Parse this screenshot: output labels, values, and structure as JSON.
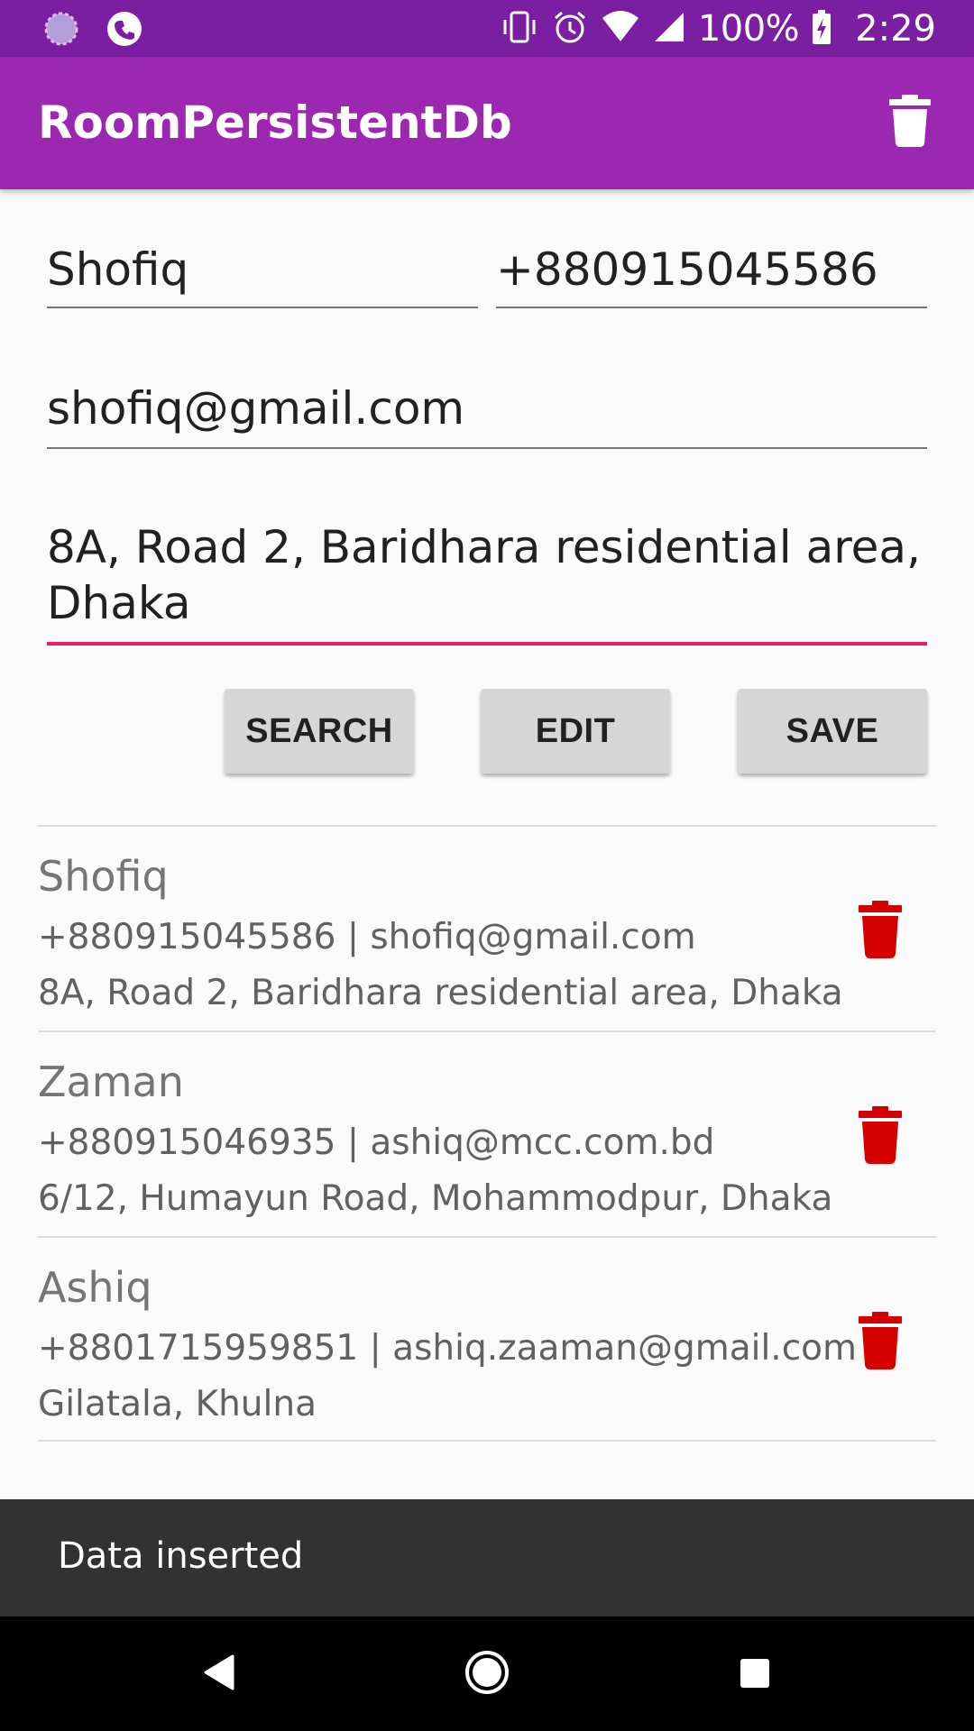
{
  "status_bar": {
    "battery": "100%",
    "time": "2:29"
  },
  "app_bar": {
    "title": "RoomPersistentDb"
  },
  "form": {
    "name": "Shofiq",
    "phone": "+880915045586",
    "email": "shofiq@gmail.com",
    "address": "8A, Road 2, Baridhara residential area, Dhaka"
  },
  "buttons": {
    "search": "SEARCH",
    "edit": "EDIT",
    "save": "SAVE"
  },
  "contacts": [
    {
      "name": "Shofiq",
      "contact": "+880915045586 | shofiq@gmail.com",
      "address": "8A, Road 2, Baridhara residential area, Dhaka"
    },
    {
      "name": "Zaman",
      "contact": "+880915046935 | ashiq@mcc.com.bd",
      "address": "6/12, Humayun Road, Mohammodpur, Dhaka"
    },
    {
      "name": "Ashiq",
      "contact": "+8801715959851 | ashiq.zaaman@gmail.com",
      "address": "Gilatala, Khulna"
    }
  ],
  "snackbar": {
    "message": "Data inserted"
  },
  "colors": {
    "status_bar": "#7b1fa2",
    "app_bar": "#9c27b0",
    "accent": "#e91e63",
    "delete_icon": "#d50000"
  },
  "icons": {
    "status_left": [
      "loading-icon",
      "phone-icon"
    ],
    "status_right": [
      "vibrate-icon",
      "alarm-icon",
      "wifi-icon",
      "signal-icon",
      "battery-icon"
    ],
    "app_bar_action": "trash-icon",
    "row_action": "trash-icon",
    "nav": [
      "back-icon",
      "home-icon",
      "recents-icon"
    ]
  }
}
